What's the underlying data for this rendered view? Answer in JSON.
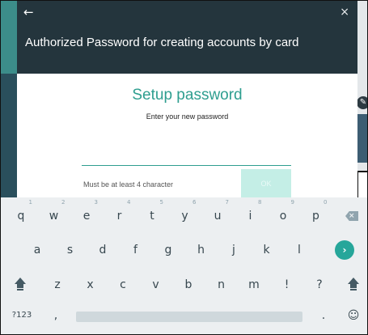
{
  "dialog": {
    "back_icon": "←",
    "close_icon": "×",
    "title": "Authorized Password for creating accounts by card",
    "setup_title": "Setup password",
    "subtitle": "Enter your new password",
    "password_value": "",
    "hint": "Must be at least 4 character",
    "ok_label": "OK"
  },
  "colors": {
    "accent": "#2e9e8f",
    "header_bg": "#24353d",
    "ok_bg": "#c4eee6",
    "keyboard_bg": "#eceff1",
    "enter_bg": "#26a69a"
  },
  "keyboard": {
    "row1": [
      {
        "label": "q",
        "hint": "1"
      },
      {
        "label": "w",
        "hint": "2"
      },
      {
        "label": "e",
        "hint": "3"
      },
      {
        "label": "r",
        "hint": "4"
      },
      {
        "label": "t",
        "hint": "5"
      },
      {
        "label": "y",
        "hint": "6"
      },
      {
        "label": "u",
        "hint": "7"
      },
      {
        "label": "i",
        "hint": "8"
      },
      {
        "label": "o",
        "hint": "9"
      },
      {
        "label": "p",
        "hint": "0"
      }
    ],
    "row2": [
      "a",
      "s",
      "d",
      "f",
      "g",
      "h",
      "j",
      "k",
      "l"
    ],
    "row3": [
      "z",
      "x",
      "c",
      "v",
      "b",
      "n",
      "m",
      "!",
      "?"
    ],
    "symbols_label": "?123",
    "comma_label": ",",
    "period_label": ".",
    "emoji_icon": "☺",
    "enter_icon": "›",
    "backspace_icon": "×",
    "icons": [
      "backspace-icon",
      "enter-icon",
      "shift-icon",
      "emoji-icon"
    ]
  },
  "background": {
    "edit_icon": "✎"
  }
}
